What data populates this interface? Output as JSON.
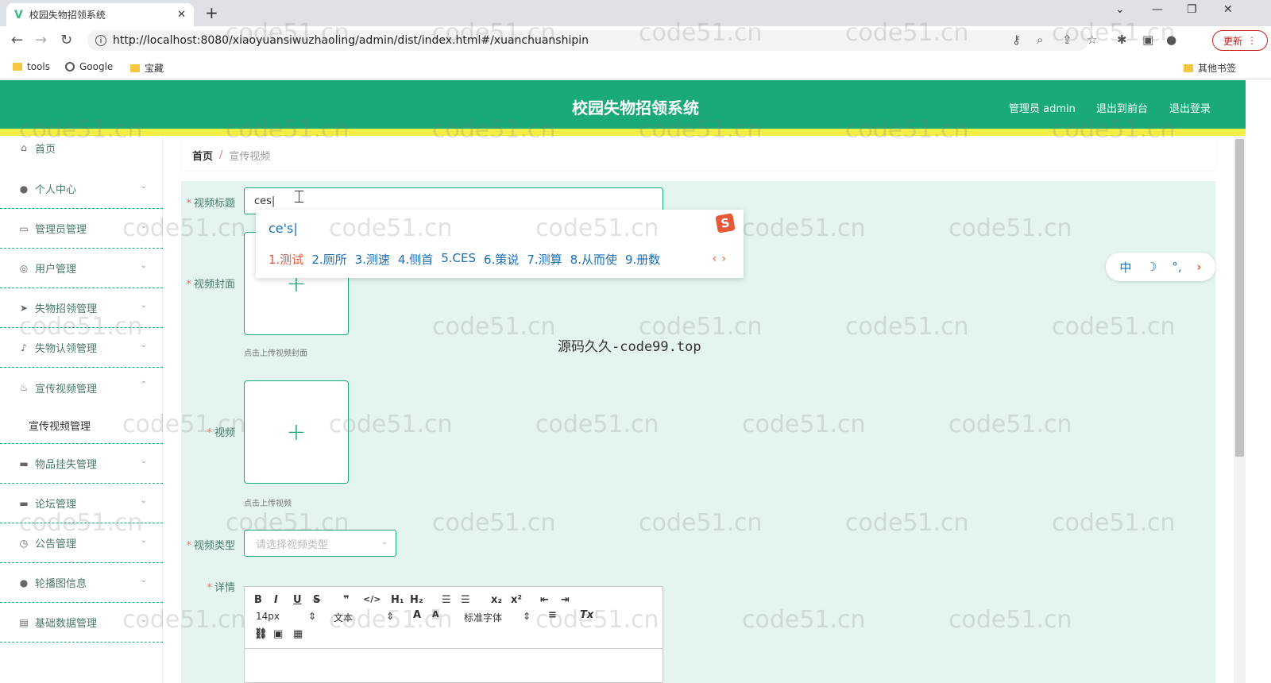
{
  "browser": {
    "tab_title": "校园失物招领系统",
    "url": "http://localhost:8080/xiaoyuansiwuzhaoling/admin/dist/index.html#/xuanchuanshipin",
    "update_label": "更新",
    "bookmarks": [
      "tools",
      "Google",
      "宝藏"
    ],
    "other_bookmarks": "其他书签"
  },
  "header": {
    "title": "校园失物招领系统",
    "user": "管理员 admin",
    "back_front": "退出到前台",
    "logout": "退出登录"
  },
  "sidebar": {
    "items": [
      {
        "label": "首页",
        "icon": "home-icon"
      },
      {
        "label": "个人中心",
        "icon": "user-icon"
      },
      {
        "label": "管理员管理",
        "icon": "admin-icon"
      },
      {
        "label": "用户管理",
        "icon": "users-icon"
      },
      {
        "label": "失物招领管理",
        "icon": "send-icon"
      },
      {
        "label": "失物认领管理",
        "icon": "mic-icon"
      },
      {
        "label": "宣传视频管理",
        "icon": "bell-icon"
      },
      {
        "label": "物品挂失管理",
        "icon": "briefcase-icon"
      },
      {
        "label": "论坛管理",
        "icon": "monitor-icon"
      },
      {
        "label": "公告管理",
        "icon": "clock-icon"
      },
      {
        "label": "轮播图信息",
        "icon": "user-icon"
      },
      {
        "label": "基础数据管理",
        "icon": "doc-icon"
      }
    ],
    "sub_item": "宣传视频管理"
  },
  "breadcrumb": {
    "home": "首页",
    "sep": "/",
    "current": "宣传视频"
  },
  "form": {
    "title_label": "视频标题",
    "title_value": "ces",
    "cover_label": "视频封面",
    "cover_hint": "点击上传视频封面",
    "video_label": "视频",
    "video_hint": "点击上传视频",
    "type_label": "视频类型",
    "type_placeholder": "请选择视频类型",
    "detail_label": "详情"
  },
  "editor": {
    "font_size": "14px",
    "block_type": "文本",
    "font_family": "标准字体"
  },
  "ime": {
    "input": "ce's",
    "candidates": [
      "1.测试",
      "2.厕所",
      "3.测速",
      "4.侧首",
      "5.CES",
      "6.策说",
      "7.测算",
      "8.从而使",
      "9.册数"
    ],
    "toolbar": [
      "中",
      "☽",
      "°,",
      "›"
    ]
  },
  "watermark": "code51.cn",
  "center_text": "源码久久-code99.top"
}
